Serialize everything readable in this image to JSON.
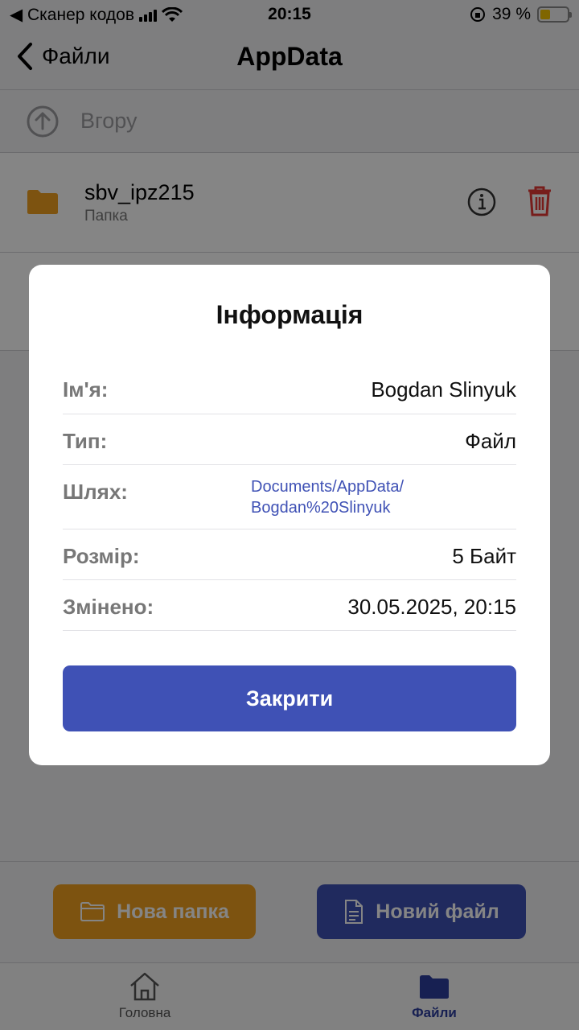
{
  "status_bar": {
    "carrier": "◀ Сканер кодов",
    "time": "20:15",
    "battery_percent": "39 %",
    "battery_level": 0.39
  },
  "navbar": {
    "back_label": "Файли",
    "title": "AppData"
  },
  "up_row": {
    "label": "Вгору"
  },
  "items": [
    {
      "name": "sbv_ipz215",
      "type": "Папка"
    }
  ],
  "bottom_actions": {
    "new_folder": "Нова папка",
    "new_file": "Новий файл"
  },
  "tabs": [
    {
      "label": "Головна",
      "icon": "home-icon"
    },
    {
      "label": "Файли",
      "icon": "folder-icon",
      "active": true
    }
  ],
  "modal": {
    "title": "Інформація",
    "rows": [
      {
        "key": "Ім'я:",
        "value": "Bogdan Slinyuk"
      },
      {
        "key": "Тип:",
        "value": "Файл"
      },
      {
        "key": "Шлях:",
        "value_line1": "Documents/AppData/",
        "value_line2": "Bogdan%20Slinyuk"
      },
      {
        "key": "Розмір:",
        "value": "5 Байт"
      },
      {
        "key": "Змінено:",
        "value": "30.05.2025, 20:15"
      }
    ],
    "close_label": "Закрити"
  },
  "colors": {
    "primary": "#3f51b5",
    "folder": "#f0a020",
    "delete": "#e53935"
  }
}
